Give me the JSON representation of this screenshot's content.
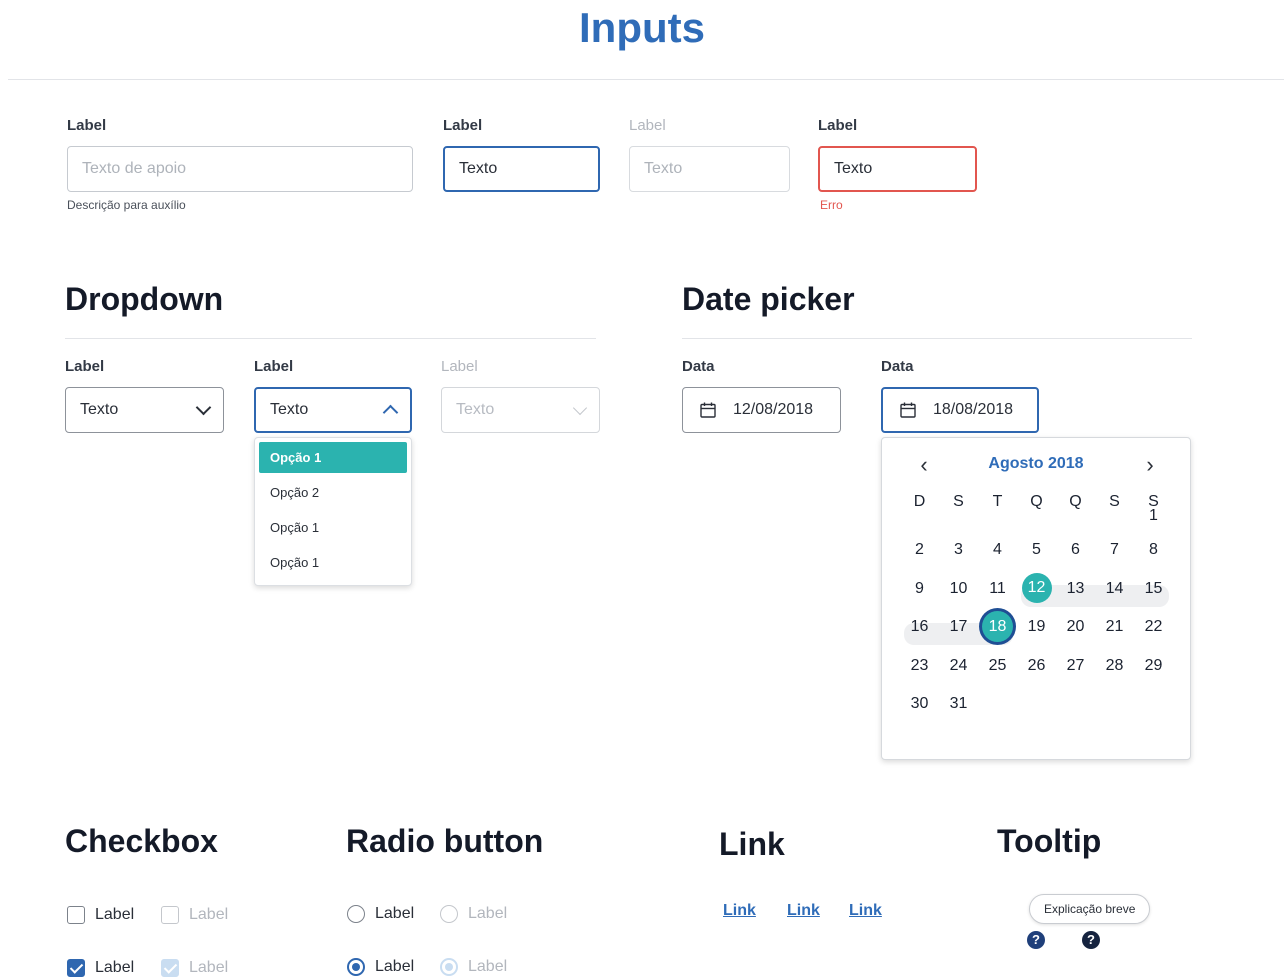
{
  "page": {
    "title": "Inputs"
  },
  "inputs": {
    "default": {
      "label": "Label",
      "placeholder": "Texto de apoio",
      "helper": "Descrição para auxílio"
    },
    "focused": {
      "label": "Label",
      "value": "Texto"
    },
    "disabled": {
      "label": "Label",
      "placeholder": "Texto"
    },
    "error": {
      "label": "Label",
      "value": "Texto",
      "error_text": "Erro"
    }
  },
  "dropdown": {
    "title": "Dropdown",
    "default": {
      "label": "Label",
      "value": "Texto"
    },
    "open": {
      "label": "Label",
      "value": "Texto",
      "options": [
        "Opção 1",
        "Opção 2",
        "Opção 1",
        "Opção 1"
      ],
      "selected_index": 0
    },
    "disabled": {
      "label": "Label",
      "value": "Texto"
    }
  },
  "datepicker": {
    "title": "Date picker",
    "field1": {
      "label": "Data",
      "value": "12/08/2018"
    },
    "field2": {
      "label": "Data",
      "value": "18/08/2018"
    },
    "calendar": {
      "month": "Agosto 2018",
      "prev": "‹",
      "next": "›",
      "weekdays": [
        "D",
        "S",
        "T",
        "Q",
        "Q",
        "S",
        "S"
      ],
      "first_weekday_index": 6,
      "days_in_month": 31,
      "range_start": 12,
      "range_end": 18
    }
  },
  "checkbox": {
    "title": "Checkbox",
    "items": [
      {
        "label": "Label",
        "checked": false,
        "disabled": false
      },
      {
        "label": "Label",
        "checked": false,
        "disabled": true
      },
      {
        "label": "Label",
        "checked": true,
        "disabled": false
      },
      {
        "label": "Label",
        "checked": true,
        "disabled": true
      }
    ]
  },
  "radio": {
    "title": "Radio button",
    "items": [
      {
        "label": "Label",
        "checked": false,
        "disabled": false
      },
      {
        "label": "Label",
        "checked": false,
        "disabled": true
      },
      {
        "label": "Label",
        "checked": true,
        "disabled": false
      },
      {
        "label": "Label",
        "checked": true,
        "disabled": true
      }
    ]
  },
  "links": {
    "title": "Link",
    "items": [
      "Link",
      "Link",
      "Link"
    ]
  },
  "tooltip": {
    "title": "Tooltip",
    "text": "Explicação breve",
    "icon_glyph": "?"
  },
  "colors": {
    "primary": "#2f67b0",
    "teal": "#2bb3af",
    "error": "#e2564f",
    "title_blue": "#2f6cb8"
  }
}
